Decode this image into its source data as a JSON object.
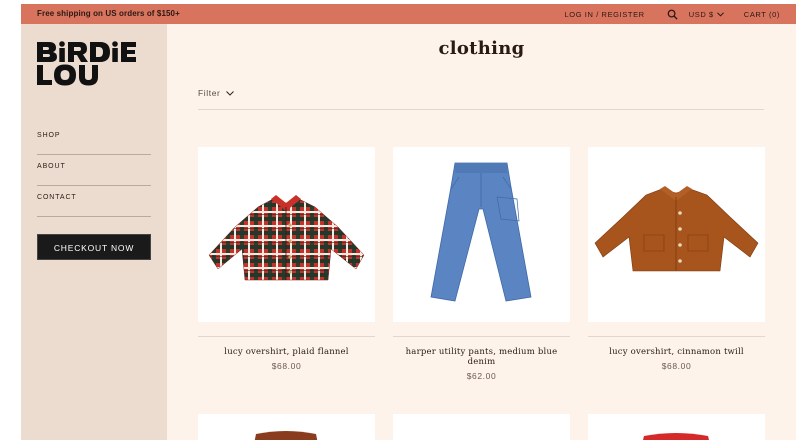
{
  "topbar": {
    "promo": "Free shipping on US orders of $150+",
    "login": "LOG IN / REGISTER",
    "currency": "USD $",
    "cart": "CART (0)"
  },
  "brand": {
    "logo_text": "BiRDiE LOU"
  },
  "sidebar": {
    "items": [
      {
        "label": "SHOP"
      },
      {
        "label": "ABOUT"
      },
      {
        "label": "CONTACT"
      }
    ],
    "checkout_label": "CHECKOUT NOW"
  },
  "main": {
    "title": "clothing",
    "filter_label": "Filter",
    "products": [
      {
        "name": "lucy overshirt, plaid flannel",
        "price": "$68.00"
      },
      {
        "name": "harper utility pants, medium blue denim",
        "price": "$62.00"
      },
      {
        "name": "lucy overshirt, cinnamon twill",
        "price": "$68.00"
      }
    ]
  },
  "colors": {
    "topbar": "#d8735e",
    "sidebar": "#ecdcd0",
    "page": "#fdf3ea",
    "checkout": "#1a1a1a"
  }
}
